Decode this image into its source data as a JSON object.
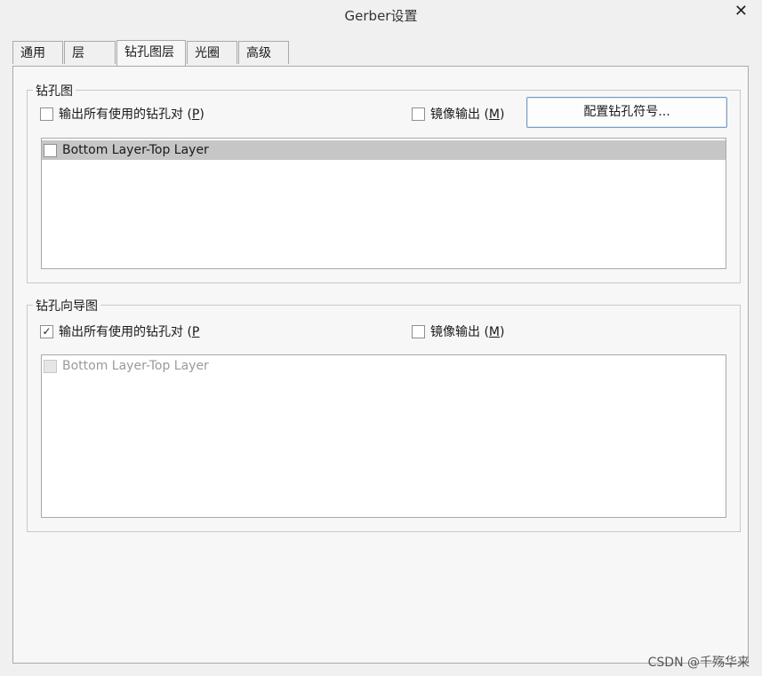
{
  "window": {
    "title": "Gerber设置",
    "close_glyph": "✕"
  },
  "tabs": [
    {
      "label": "通用"
    },
    {
      "label": "层"
    },
    {
      "label": "钻孔图层",
      "active": true
    },
    {
      "label": "光圈"
    },
    {
      "label": "高级"
    }
  ],
  "drill_drawing": {
    "legend": "钻孔图",
    "plot_all_used": {
      "label": "输出所有使用的钻孔对 (",
      "accel": "P",
      "suffix": ")",
      "checked": false
    },
    "mirror": {
      "label": "镜像输出 (",
      "accel": "M",
      "suffix": ")",
      "checked": false
    },
    "configure_button": "配置钻孔符号...",
    "layer_pairs": [
      {
        "label": "Bottom Layer-Top Layer",
        "checked": false,
        "selected": true
      }
    ]
  },
  "drill_guide": {
    "legend": "钻孔向导图",
    "plot_all_used": {
      "label": "输出所有使用的钻孔对 (",
      "accel": "P",
      "suffix": "",
      "checked": true,
      "check_glyph": "✓"
    },
    "mirror": {
      "label": "镜像输出 (",
      "accel": "M",
      "suffix": ")",
      "checked": false
    },
    "layer_pairs": [
      {
        "label": "Bottom Layer-Top Layer",
        "checked": false,
        "disabled": true
      }
    ]
  },
  "watermark": "CSDN @千殇华来"
}
